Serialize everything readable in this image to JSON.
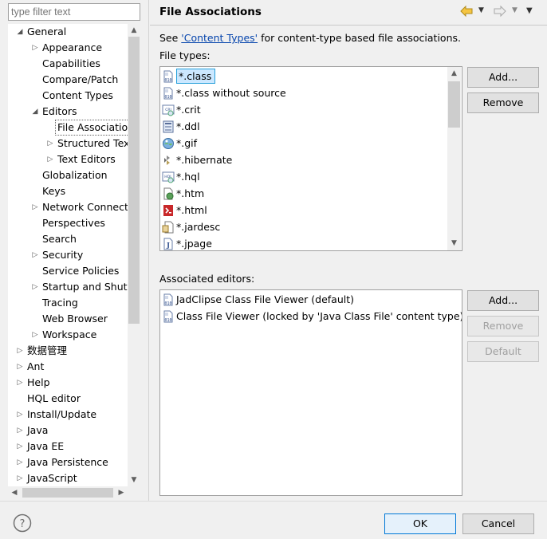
{
  "filter": {
    "placeholder": "type filter text"
  },
  "tree": [
    {
      "label": "General",
      "indent": 1,
      "arrow": "expanded"
    },
    {
      "label": "Appearance",
      "indent": 2,
      "arrow": "collapsed"
    },
    {
      "label": "Capabilities",
      "indent": 2,
      "arrow": "none"
    },
    {
      "label": "Compare/Patch",
      "indent": 2,
      "arrow": "none"
    },
    {
      "label": "Content Types",
      "indent": 2,
      "arrow": "none"
    },
    {
      "label": "Editors",
      "indent": 2,
      "arrow": "expanded"
    },
    {
      "label": "File Associations",
      "indent": 3,
      "arrow": "none",
      "selected": true
    },
    {
      "label": "Structured Text Editors",
      "indent": 3,
      "arrow": "collapsed"
    },
    {
      "label": "Text Editors",
      "indent": 3,
      "arrow": "collapsed"
    },
    {
      "label": "Globalization",
      "indent": 2,
      "arrow": "none"
    },
    {
      "label": "Keys",
      "indent": 2,
      "arrow": "none"
    },
    {
      "label": "Network Connections",
      "indent": 2,
      "arrow": "collapsed"
    },
    {
      "label": "Perspectives",
      "indent": 2,
      "arrow": "none"
    },
    {
      "label": "Search",
      "indent": 2,
      "arrow": "none"
    },
    {
      "label": "Security",
      "indent": 2,
      "arrow": "collapsed"
    },
    {
      "label": "Service Policies",
      "indent": 2,
      "arrow": "none"
    },
    {
      "label": "Startup and Shutdown",
      "indent": 2,
      "arrow": "collapsed"
    },
    {
      "label": "Tracing",
      "indent": 2,
      "arrow": "none"
    },
    {
      "label": "Web Browser",
      "indent": 2,
      "arrow": "none"
    },
    {
      "label": "Workspace",
      "indent": 2,
      "arrow": "collapsed"
    },
    {
      "label": "数据管理",
      "indent": 1,
      "arrow": "collapsed"
    },
    {
      "label": "Ant",
      "indent": 1,
      "arrow": "collapsed"
    },
    {
      "label": "Help",
      "indent": 1,
      "arrow": "collapsed"
    },
    {
      "label": "HQL editor",
      "indent": 1,
      "arrow": "none"
    },
    {
      "label": "Install/Update",
      "indent": 1,
      "arrow": "collapsed"
    },
    {
      "label": "Java",
      "indent": 1,
      "arrow": "collapsed"
    },
    {
      "label": "Java EE",
      "indent": 1,
      "arrow": "collapsed"
    },
    {
      "label": "Java Persistence",
      "indent": 1,
      "arrow": "collapsed"
    },
    {
      "label": "JavaScript",
      "indent": 1,
      "arrow": "collapsed"
    }
  ],
  "header": {
    "title": "File Associations",
    "back_icon": "back-arrow-icon",
    "forward_icon": "forward-arrow-icon",
    "menu_icon": "view-menu-icon"
  },
  "description": {
    "prefix": "See ",
    "link": "'Content Types'",
    "suffix": " for content-type based file associations."
  },
  "file_types": {
    "label": "File types:",
    "items": [
      {
        "name": "*.class",
        "icon": "class-file-icon",
        "selected": true
      },
      {
        "name": "*.class without source",
        "icon": "class-file-icon"
      },
      {
        "name": "*.crit",
        "icon": "crit-file-icon"
      },
      {
        "name": "*.ddl",
        "icon": "ddl-file-icon"
      },
      {
        "name": "*.gif",
        "icon": "image-file-icon"
      },
      {
        "name": "*.hibernate",
        "icon": "hibernate-file-icon"
      },
      {
        "name": "*.hql",
        "icon": "hql-file-icon"
      },
      {
        "name": "*.htm",
        "icon": "web-file-icon"
      },
      {
        "name": "*.html",
        "icon": "html-file-icon"
      },
      {
        "name": "*.jardesc",
        "icon": "jardesc-file-icon"
      },
      {
        "name": "*.jpage",
        "icon": "jpage-file-icon"
      }
    ],
    "add_label": "Add...",
    "remove_label": "Remove"
  },
  "associated_editors": {
    "label": "Associated editors:",
    "items": [
      {
        "name": "JadClipse Class File Viewer (default)",
        "icon": "class-file-icon"
      },
      {
        "name": "Class File Viewer (locked by 'Java Class File' content type)",
        "icon": "class-file-icon"
      }
    ],
    "add_label": "Add...",
    "remove_label": "Remove",
    "default_label": "Default"
  },
  "footer": {
    "ok_label": "OK",
    "cancel_label": "Cancel",
    "help_icon": "help-icon"
  }
}
